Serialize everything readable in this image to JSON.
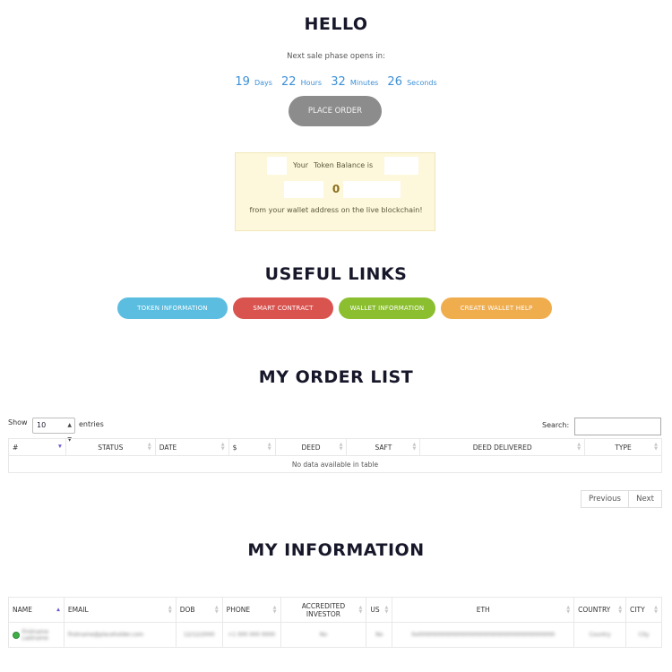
{
  "hello": {
    "title": "HELLO"
  },
  "sale": {
    "caption": "Next sale phase opens in:",
    "days_value": "19",
    "days_unit": "Days",
    "hours_value": "22",
    "hours_unit": "Hours",
    "minutes_value": "32",
    "minutes_unit": "Minutes",
    "seconds_value": "26",
    "seconds_unit": "Seconds",
    "place_order_label": "PLACE ORDER"
  },
  "balance": {
    "prefix": "Your",
    "label": "Token Balance is",
    "value": "0",
    "suffix": "from your wallet address on the live blockchain!"
  },
  "useful_links": {
    "title": "USEFUL LINKS",
    "token_information": "TOKEN INFORMATION",
    "smart_contract": "SMART CONTRACT",
    "wallet_information": "WALLET INFORMATION",
    "create_wallet_help": "CREATE WALLET HELP"
  },
  "orders": {
    "title": "MY ORDER LIST",
    "show_label": "Show",
    "entries_value": "10",
    "entries_label": "entries",
    "search_label": "Search:",
    "search_value": "",
    "columns": [
      "#",
      "STATUS",
      "DATE",
      "$",
      "DEED",
      "SAFT",
      "DEED DELIVERED",
      "TYPE"
    ],
    "empty_message": "No data available in table",
    "previous_label": "Previous",
    "next_label": "Next"
  },
  "info": {
    "title": "MY INFORMATION",
    "columns": [
      "NAME",
      "EMAIL",
      "DOB",
      "PHONE",
      "ACCREDITED INVESTOR",
      "US",
      "ETH",
      "COUNTRY",
      "CITY"
    ],
    "row": {
      "name": "Firstname Lastname",
      "email": "firstname@placeholder.com",
      "dob": "12/12/2000",
      "phone": "+1 000 000 0000",
      "accredited": "No",
      "us": "No",
      "eth": "0x0000000000000000000000000000000000000000",
      "country": "Country",
      "city": "City"
    }
  },
  "colors": {
    "token_information": "#5bbde0",
    "smart_contract": "#d9534f",
    "wallet_information": "#8bbf30",
    "create_wallet_help": "#f0ad4e",
    "countdown": "#3d8fd6",
    "place_order": "#8c8c8c"
  }
}
